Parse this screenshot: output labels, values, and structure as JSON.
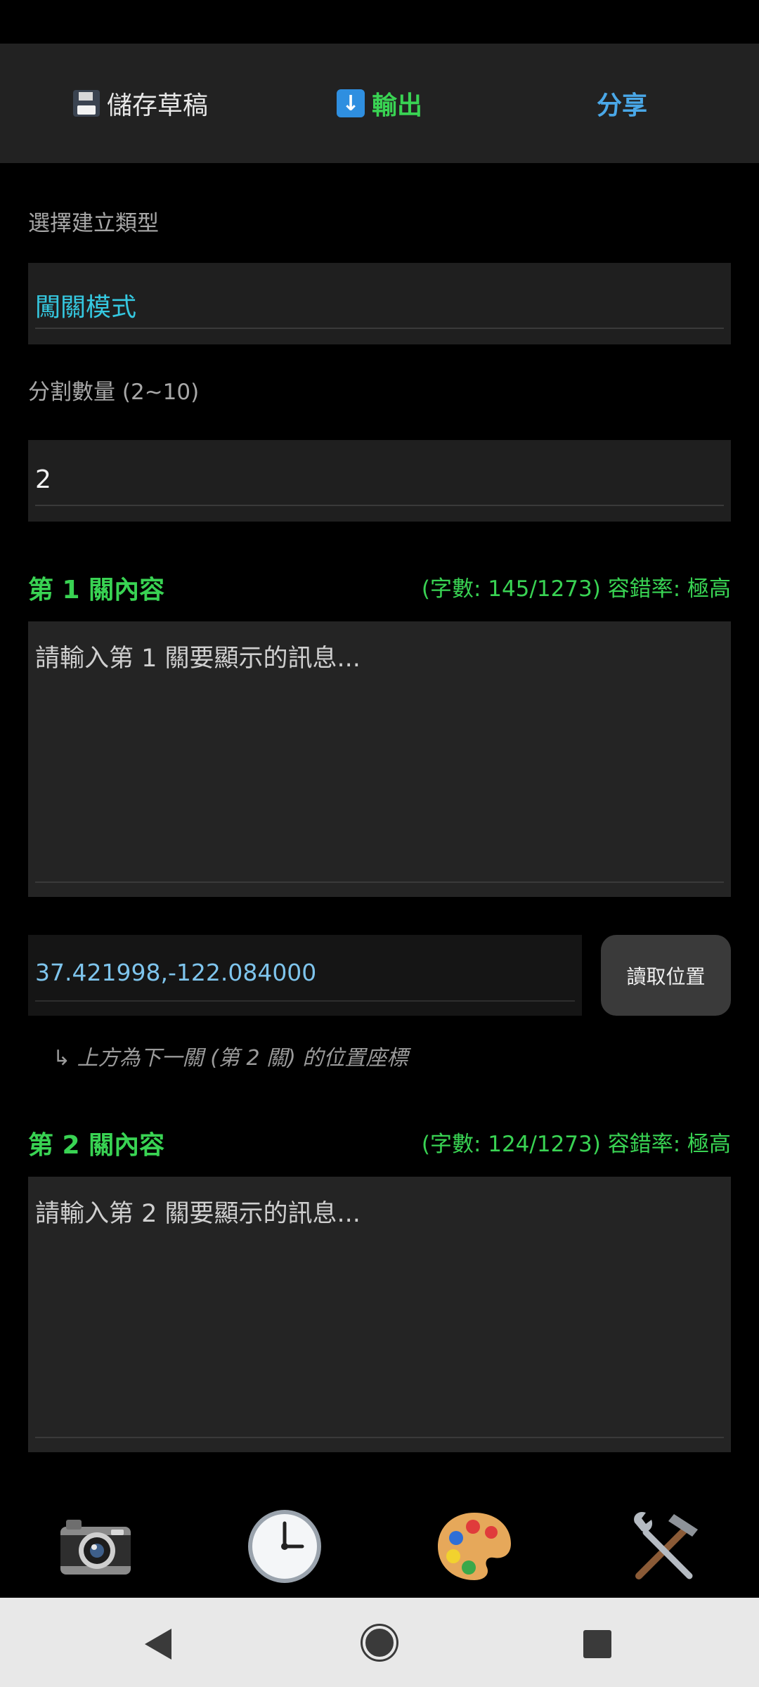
{
  "toolbar": {
    "save_label": "儲存草稿",
    "export_label": "輸出",
    "share_label": "分享",
    "save_icon": "floppy-disk-icon",
    "export_icon": "download-arrow-icon"
  },
  "form": {
    "type_label": "選擇建立類型",
    "type_value": "闖關模式",
    "count_label": "分割數量 (2~10)",
    "count_value": "2"
  },
  "levels": [
    {
      "title": "第 1 關內容",
      "meta": "(字數: 145/1273) 容錯率: 極高",
      "placeholder": "請輸入第 1 關要顯示的訊息..."
    },
    {
      "title": "第 2 關內容",
      "meta": "(字數: 124/1273) 容錯率: 極高",
      "placeholder": "請輸入第 2 關要顯示的訊息..."
    }
  ],
  "location": {
    "value": "37.421998,-122.084000",
    "button_label": "讀取位置",
    "hint": "↳ 上方為下一關 (第 2 關) 的位置座標"
  },
  "bottom_nav": [
    {
      "icon": "camera-icon"
    },
    {
      "icon": "clock-icon"
    },
    {
      "icon": "palette-icon"
    },
    {
      "icon": "tools-icon"
    }
  ],
  "colors": {
    "accent_green": "#39d353",
    "accent_cyan": "#35c8e0",
    "accent_blue": "#4aa8e8"
  }
}
